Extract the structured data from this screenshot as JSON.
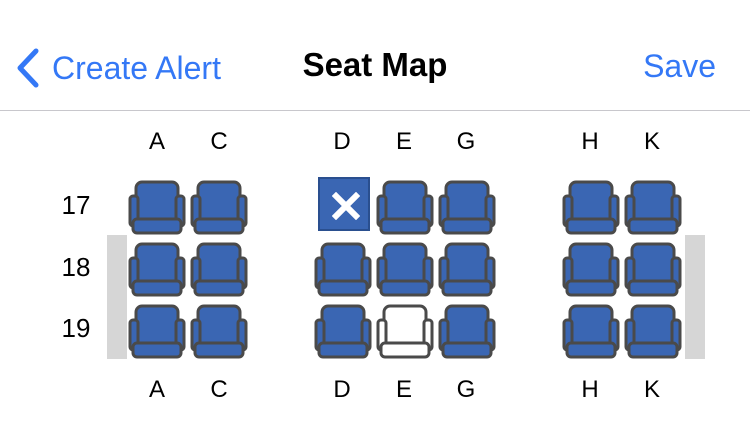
{
  "nav": {
    "back_label": "Create Alert",
    "title": "Seat Map",
    "save_label": "Save"
  },
  "columns": [
    "A",
    "C",
    "D",
    "E",
    "G",
    "H",
    "K"
  ],
  "rows": [
    "17",
    "18",
    "19"
  ],
  "seat_states": {
    "17": [
      "available",
      "available",
      "blocked",
      "available",
      "available",
      "available",
      "available"
    ],
    "18": [
      "available",
      "available",
      "available",
      "available",
      "available",
      "available",
      "available"
    ],
    "19": [
      "available",
      "available",
      "available",
      "selected",
      "available",
      "available",
      "available"
    ]
  },
  "colors": {
    "accent": "#3478f6",
    "seat_fill": "#3a66b3",
    "seat_outline": "#4a4a4a",
    "blocked_fill": "#3a66b3",
    "wing": "#d6d6d6"
  },
  "icons": {
    "back": "chevron-left-icon",
    "blocked_seat": "x-mark-icon"
  }
}
